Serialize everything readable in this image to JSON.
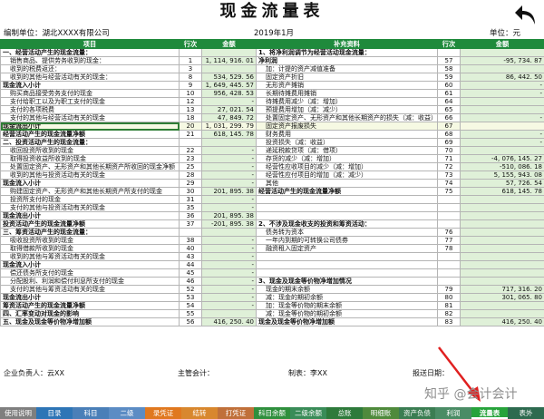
{
  "title": "现金流量表",
  "header": {
    "unit_label": "编制单位：湖北XXXX有限公司",
    "period": "2019年1月",
    "currency": "单位：元"
  },
  "table": {
    "headers": [
      "项目",
      "行次",
      "金额",
      "补充资料",
      "行次",
      "金额"
    ],
    "rows": [
      [
        "一、经营活动产生的现金流量：",
        "",
        "",
        "1、将净利润调节为经营活动现金流量：",
        "",
        ""
      ],
      [
        "销售商品、提供劳务收到的现金：",
        "1",
        "1, 114, 916. 01",
        "净利润",
        "57",
        "-95, 734. 87"
      ],
      [
        "收到的税费返还：",
        "3",
        "",
        "加：计提的资产减值准备",
        "58",
        ""
      ],
      [
        "收到的其他与经营活动有关的现金：",
        "8",
        "534, 529. 56",
        "固定资产折旧",
        "59",
        "86, 442. 50"
      ],
      [
        "现金流入小计",
        "9",
        "1, 649, 445. 57",
        "无形资产摊销",
        "60",
        "-"
      ],
      [
        "购买商品接受劳务支付的现金",
        "10",
        "956, 428. 53",
        "长期待摊费用摊销",
        "61",
        "-"
      ],
      [
        "支付给职工以及为职工支付的现金",
        "12",
        "-",
        "待摊费用减少（减：增加）",
        "64",
        ""
      ],
      [
        "支付的各项税费",
        "13",
        "27, 021. 54",
        "预提费用增加（减：减少）",
        "65",
        ""
      ],
      [
        "支付的其他与经营活动有关的现金",
        "18",
        "47, 849. 72",
        "处置固定资产、无形资产和其他长期资产的损失（减：收益）",
        "66",
        "-"
      ],
      [
        "现金流出小计",
        "20",
        "1, 031, 299. 79",
        "固定资产报废损失",
        "67",
        ""
      ],
      [
        "经营活动产生的现金流量净额",
        "21",
        "618, 145. 78",
        "财务费用",
        "68",
        "-"
      ],
      [
        "二、投资活动产生的现金流量：",
        "",
        "",
        "投资损失（减：收益）",
        "69",
        "-"
      ],
      [
        "收回投资所收到的现金",
        "22",
        "-",
        "递延税款贷项（减：借项）",
        "70",
        ""
      ],
      [
        "取得投资收益所收到的现金",
        "23",
        "-",
        "存货的减少（减：增加）",
        "71",
        "-4, 076, 145. 27"
      ],
      [
        "处置固定资产、无形资产和其他长期资产所收回的现金净额",
        "25",
        "-",
        "经营性应收项目的减少（减：增加）",
        "72",
        "-510, 086. 18"
      ],
      [
        "收到的其他与投资活动有关的现金",
        "28",
        "-",
        "经营性应付项目的增加（减：减少）",
        "73",
        "5, 155, 943. 08"
      ],
      [
        "现金流入小计",
        "29",
        "-",
        "其他",
        "74",
        "57, 726. 54"
      ],
      [
        "购建固定资产、无形资产和其他长期资产所支付的现金",
        "30",
        "201, 895. 38",
        "经营活动产生的现金流量净额",
        "75",
        "618, 145. 78"
      ],
      [
        "投资所支付的现金",
        "31",
        "-",
        "",
        "",
        ""
      ],
      [
        "支付的其他与投资活动有关的现金",
        "35",
        "-",
        "",
        "",
        ""
      ],
      [
        "现金流出小计",
        "36",
        "201, 895. 38",
        "",
        "",
        ""
      ],
      [
        "投资活动产生的现金流量净额",
        "37",
        "-201, 895. 38",
        "2、不涉及现金收支的投资和筹资活动：",
        "",
        ""
      ],
      [
        "三、筹资活动产生的现金流量：",
        "",
        "",
        "债务转为资本",
        "76",
        ""
      ],
      [
        "吸收投资所收到的现金",
        "38",
        "-",
        "一年内到期的可转换公司债券",
        "77",
        ""
      ],
      [
        "取得借款所收到的现金",
        "40",
        "-",
        "融资租入固定资产",
        "78",
        ""
      ],
      [
        "收到的其他与筹资活动有关的现金",
        "43",
        "-",
        "",
        "",
        ""
      ],
      [
        "现金流入小计",
        "44",
        "-",
        "",
        "",
        ""
      ],
      [
        "偿还债务所支付的现金",
        "45",
        "-",
        "",
        "",
        ""
      ],
      [
        "分配股利、利润和偿付利息所支付的现金",
        "46",
        "-",
        "3、现金及现金等价物净增加情况",
        "",
        ""
      ],
      [
        "支付的其他与筹资活动有关的现金",
        "52",
        "-",
        "现金的期末余额",
        "79",
        "717, 316. 20"
      ],
      [
        "现金流出小计",
        "53",
        "-",
        "减：现金的期初余额",
        "80",
        "301, 065. 80"
      ],
      [
        "筹资活动产生的现金流量净额",
        "54",
        "-",
        "加：现金等价物的期末余额",
        "81",
        ""
      ],
      [
        "四、汇率变动对现金的影响",
        "55",
        "",
        "减：现金等价物的期初余额",
        "82",
        ""
      ],
      [
        "五、现金及现金等价物净增加额",
        "56",
        "416, 250. 40",
        "现金及现金等价物净增加额",
        "83",
        "416, 250. 40"
      ]
    ]
  },
  "footer": {
    "person": "企业负责人：云XX",
    "accountant": "主管会计：",
    "preparer": "制表：李XX",
    "date": "报送日期："
  },
  "watermark": "知乎 @会计会计",
  "tabs": [
    {
      "label": "使用说明",
      "color": "#7f7f7f"
    },
    {
      "label": "目录",
      "color": "#2e75b6"
    },
    {
      "label": "科目",
      "color": "#4a7fb8"
    },
    {
      "label": "二级",
      "color": "#5b8cc4"
    },
    {
      "label": "录凭证",
      "color": "#e0781f"
    },
    {
      "label": "结转",
      "color": "#d8872e"
    },
    {
      "label": "打凭证",
      "color": "#c0703a"
    },
    {
      "label": "科目余额",
      "color": "#2f8f3d"
    },
    {
      "label": "二级余额",
      "color": "#3a8c58"
    },
    {
      "label": "总账",
      "color": "#2e7a3b"
    },
    {
      "label": "明细账",
      "color": "#4f8a3c"
    },
    {
      "label": "资产负债",
      "color": "#3b7d52"
    },
    {
      "label": "利润",
      "color": "#4a8c65"
    },
    {
      "label": "流量表",
      "color": "#27a33b"
    },
    {
      "label": "表外",
      "color": "#2d6a4f"
    }
  ],
  "active_tab": 13
}
